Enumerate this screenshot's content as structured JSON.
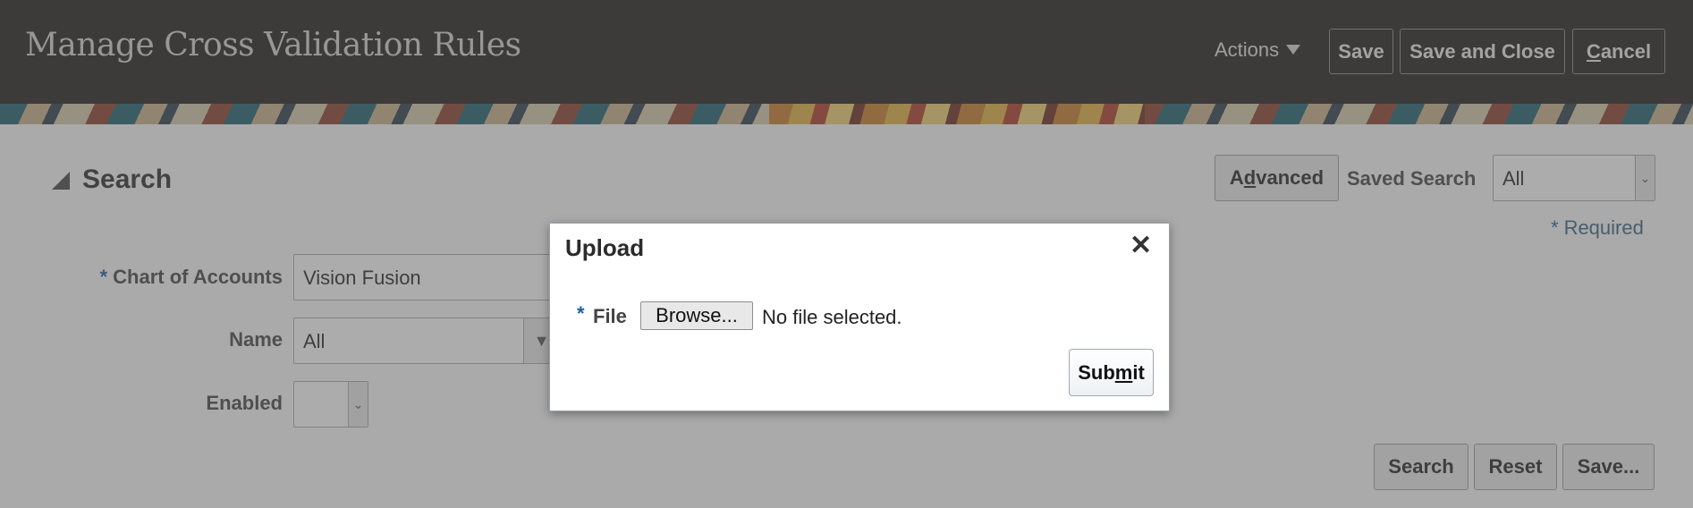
{
  "header": {
    "title": "Manage Cross Validation Rules",
    "actions_label": "Actions",
    "save_label": "Save",
    "save_close_label": "Save and Close",
    "cancel_pre": "",
    "cancel_underlined": "C",
    "cancel_post": "ancel"
  },
  "search": {
    "title": "Search",
    "advanced_pre": "A",
    "advanced_underlined": "d",
    "advanced_post": "vanced",
    "saved_search_label": "Saved Search",
    "saved_search_value": "All",
    "required_star": "*",
    "required_note": "Required",
    "fields": {
      "chart_of_accounts_label": "Chart of Accounts",
      "chart_of_accounts_value": "Vision Fusion",
      "name_label": "Name",
      "name_value": "All",
      "enabled_label": "Enabled",
      "enabled_value": ""
    },
    "search_button": "Search",
    "reset_button": "Reset",
    "save_button": "Save..."
  },
  "dialog": {
    "title": "Upload",
    "close_symbol": "✕",
    "required_star": "*",
    "file_label": "File",
    "browse_label": "Browse...",
    "no_file_text": "No file selected.",
    "submit_pre": "Sub",
    "submit_underlined": "m",
    "submit_post": "it"
  },
  "colors": {
    "header_bg": "#1e1c1a",
    "required_blue": "#1f5fa0",
    "overlay": "rgba(90,90,90,0.5)"
  },
  "icons": {
    "actions_dropdown": "caret-down-icon",
    "disclosure": "triangle-collapse-icon",
    "dialog_close": "close-icon",
    "select_arrow": "chevron-down-icon"
  }
}
